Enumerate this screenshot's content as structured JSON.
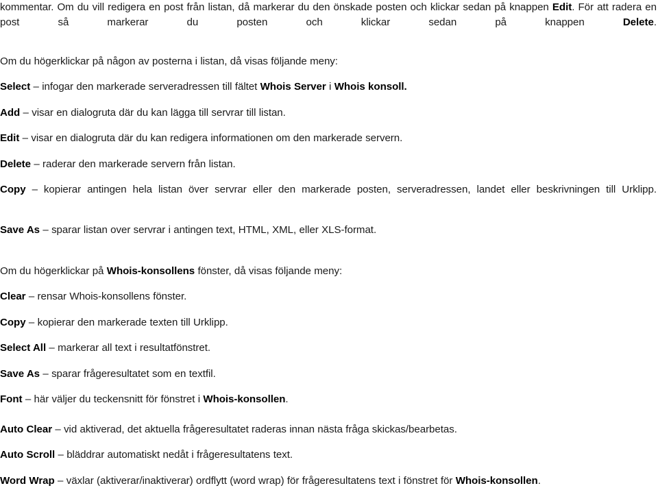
{
  "document": {
    "language": "sv",
    "paragraphs": [
      {
        "id": "intro",
        "kind": "justified-paragraph",
        "runs": [
          {
            "text": "kommentar. Om du vill redigera en post från listan, då markerar du den önskade posten och klickar sedan på knappen ",
            "bold": false
          },
          {
            "text": "Edit",
            "bold": true
          },
          {
            "text": ". För att radera en post så markerar du posten och klickar sedan på knappen ",
            "bold": false
          },
          {
            "text": "Delete",
            "bold": true
          },
          {
            "text": ".",
            "bold": false
          }
        ]
      },
      {
        "id": "list-menu-lead",
        "kind": "paragraph",
        "runs": [
          {
            "text": "Om du högerklickar på någon av posterna i listan, då visas följande meny:",
            "bold": false
          }
        ]
      },
      {
        "id": "item-select",
        "kind": "menu-item",
        "runs": [
          {
            "text": "Select",
            "bold": true
          },
          {
            "text": " – infogar den markerade serveradressen till fältet ",
            "bold": false
          },
          {
            "text": "Whois Server",
            "bold": true
          },
          {
            "text": " i ",
            "bold": false
          },
          {
            "text": "Whois konsoll",
            "bold": true
          },
          {
            "text": ".",
            "bold": true
          }
        ]
      },
      {
        "id": "item-add",
        "kind": "menu-item",
        "runs": [
          {
            "text": "Add",
            "bold": true
          },
          {
            "text": " – visar en dialogruta där du kan lägga till servrar till listan.",
            "bold": false
          }
        ]
      },
      {
        "id": "item-edit",
        "kind": "menu-item",
        "runs": [
          {
            "text": "Edit",
            "bold": true
          },
          {
            "text": " – visar en dialogruta där du kan redigera informationen om den markerade servern.",
            "bold": false
          }
        ]
      },
      {
        "id": "item-delete",
        "kind": "menu-item",
        "runs": [
          {
            "text": "Delete",
            "bold": true
          },
          {
            "text": " – raderar den markerade servern från listan.",
            "bold": false
          }
        ]
      },
      {
        "id": "item-copy-list",
        "kind": "menu-item-justified",
        "runs": [
          {
            "text": "Copy",
            "bold": true
          },
          {
            "text": " – kopierar antingen hela listan över servrar eller den markerade posten, serveradressen, landet eller beskrivningen till Urklipp.",
            "bold": false
          }
        ]
      },
      {
        "id": "item-save-as-list",
        "kind": "menu-item",
        "runs": [
          {
            "text": "Save As",
            "bold": true
          },
          {
            "text": " – sparar listan over servrar i antingen text, HTML, XML, eller XLS-format.",
            "bold": false
          }
        ]
      },
      {
        "id": "console-menu-lead",
        "kind": "paragraph",
        "runs": [
          {
            "text": "Om du högerklickar på ",
            "bold": false
          },
          {
            "text": "Whois-konsollens",
            "bold": true
          },
          {
            "text": " fönster, då visas följande meny:",
            "bold": false
          }
        ]
      },
      {
        "id": "item-clear",
        "kind": "menu-item",
        "runs": [
          {
            "text": "Clear",
            "bold": true
          },
          {
            "text": " – rensar Whois-konsollens fönster.",
            "bold": false
          }
        ]
      },
      {
        "id": "item-copy-text",
        "kind": "menu-item",
        "runs": [
          {
            "text": "Copy",
            "bold": true
          },
          {
            "text": " – kopierar den markerade texten till Urklipp.",
            "bold": false
          }
        ]
      },
      {
        "id": "item-select-all",
        "kind": "menu-item",
        "runs": [
          {
            "text": "Select All",
            "bold": true
          },
          {
            "text": " – markerar all text i resultatfönstret.",
            "bold": false
          }
        ]
      },
      {
        "id": "item-save-as-text",
        "kind": "menu-item",
        "runs": [
          {
            "text": "Save As",
            "bold": true
          },
          {
            "text": " – sparar frågeresultatet som en textfil.",
            "bold": false
          }
        ]
      },
      {
        "id": "item-font",
        "kind": "menu-item",
        "runs": [
          {
            "text": "Font",
            "bold": true
          },
          {
            "text": " – här väljer du teckensnitt för fönstret i ",
            "bold": false
          },
          {
            "text": "Whois-konsollen",
            "bold": true
          },
          {
            "text": ".",
            "bold": false
          }
        ]
      },
      {
        "id": "item-auto-clear",
        "kind": "menu-item",
        "runs": [
          {
            "text": "Auto Clear",
            "bold": true
          },
          {
            "text": " – vid aktiverad, det aktuella frågeresultatet raderas innan nästa fråga skickas/bearbetas.",
            "bold": false
          }
        ]
      },
      {
        "id": "item-auto-scroll",
        "kind": "menu-item",
        "runs": [
          {
            "text": "Auto Scroll",
            "bold": true
          },
          {
            "text": " – bläddrar automatiskt nedåt i frågeresultatens text.",
            "bold": false
          }
        ]
      },
      {
        "id": "item-word-wrap",
        "kind": "menu-item",
        "runs": [
          {
            "text": "Word Wrap",
            "bold": true
          },
          {
            "text": " – växlar (aktiverar/inaktiverar) ordflytt (word wrap) för frågeresultatens text i fönstret för ",
            "bold": false
          },
          {
            "text": "Whois-konsollen",
            "bold": true
          },
          {
            "text": ".",
            "bold": false
          }
        ]
      }
    ]
  },
  "colors": {
    "page_background": "#ffffff",
    "body_text": "#1a1a1a",
    "bold_text": "#000000"
  }
}
